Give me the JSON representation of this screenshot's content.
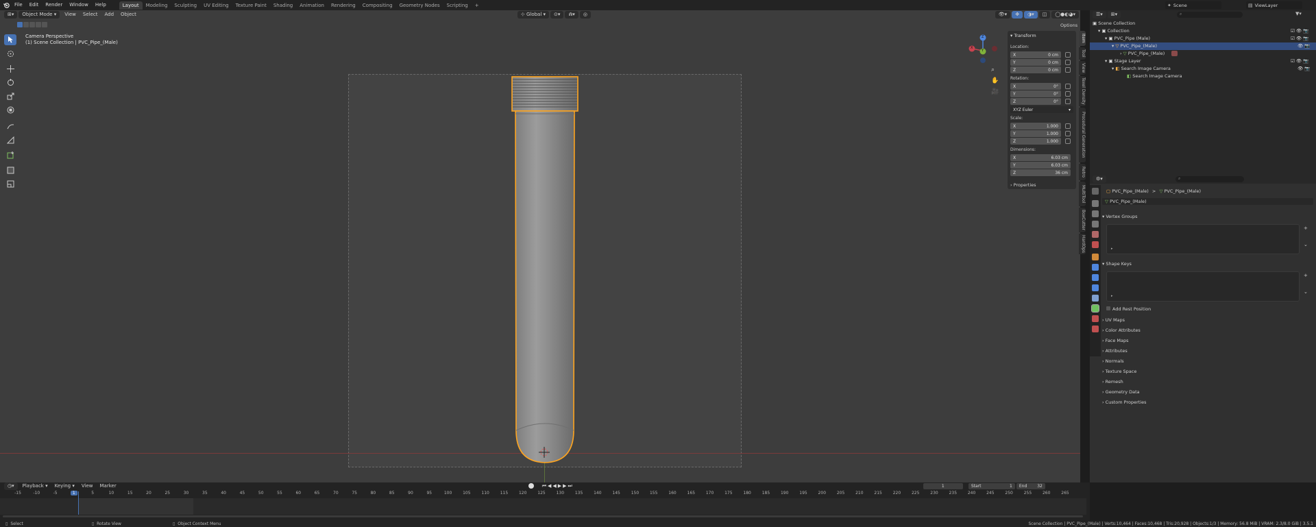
{
  "menu": {
    "items": [
      "File",
      "Edit",
      "Render",
      "Window",
      "Help"
    ]
  },
  "workspaces": {
    "tabs": [
      "Layout",
      "Modeling",
      "Sculpting",
      "UV Editing",
      "Texture Paint",
      "Shading",
      "Animation",
      "Rendering",
      "Compositing",
      "Geometry Nodes",
      "Scripting"
    ],
    "active": "Layout",
    "add": "+"
  },
  "scene": {
    "name": "Scene",
    "view_layer": "ViewLayer"
  },
  "viewport": {
    "mode": "Object Mode",
    "view": "View",
    "select": "Select",
    "add": "Add",
    "object": "Object",
    "transform_orientation": "Global",
    "options": "Options",
    "overlay_title": "Camera Perspective",
    "overlay_subtitle": "(1) Scene Collection | PVC_Pipe_(Male)",
    "gizmo_x": "X",
    "gizmo_y": "Y",
    "gizmo_z": "Z"
  },
  "npanel": {
    "transform": "Transform",
    "location_label": "Location:",
    "loc": {
      "x": "0 cm",
      "y": "0 cm",
      "z": "0 cm"
    },
    "rotation_label": "Rotation:",
    "rot": {
      "x": "0°",
      "y": "0°",
      "z": "0°"
    },
    "rotation_mode": "XYZ Euler",
    "scale_label": "Scale:",
    "scale": {
      "x": "1.000",
      "y": "1.000",
      "z": "1.000"
    },
    "dimensions_label": "Dimensions:",
    "dim": {
      "x": "6.03 cm",
      "y": "6.03 cm",
      "z": "36 cm"
    },
    "properties": "Properties",
    "axis": {
      "x": "X",
      "y": "Y",
      "z": "Z"
    },
    "tabs": [
      "Item",
      "Tool",
      "View",
      "Texel Density",
      "Procedural Generation",
      "Retro",
      "MultiTool",
      "BoxCutter",
      "HardOps"
    ]
  },
  "outliner": {
    "rows": [
      {
        "label": "Scene Collection"
      },
      {
        "label": "Collection"
      },
      {
        "label": "PVC_Pipe (Male)"
      },
      {
        "label": "PVC_Pipe_(Male)"
      },
      {
        "label": "PVC_Pipe_(Male)"
      },
      {
        "label": "Stage Layer"
      },
      {
        "label": "Search Image Camera"
      },
      {
        "label": "Search Image Camera"
      }
    ]
  },
  "properties": {
    "breadcrumb_obj": "PVC_Pipe_(Male)",
    "breadcrumb_sep": ">",
    "breadcrumb_mesh": "PVC_Pipe_(Male)",
    "data_name": "PVC_Pipe_(Male)",
    "vertex_groups": "Vertex Groups",
    "shape_keys": "Shape Keys",
    "add_rest_position": "Add Rest Position",
    "sections": [
      "UV Maps",
      "Color Attributes",
      "Face Maps",
      "Attributes",
      "Normals",
      "Texture Space",
      "Remesh",
      "Geometry Data",
      "Custom Properties"
    ]
  },
  "timeline": {
    "playback": "Playback",
    "keying": "Keying",
    "view": "View",
    "marker": "Marker",
    "current_frame": "1",
    "start_label": "Start",
    "start": "1",
    "end_label": "End",
    "end": "32",
    "ticks": [
      "-15",
      "-10",
      "-5",
      "1",
      "5",
      "10",
      "15",
      "20",
      "25",
      "30",
      "35",
      "40",
      "45",
      "50",
      "55",
      "60",
      "65",
      "70",
      "75",
      "80",
      "85",
      "90",
      "95",
      "100",
      "105",
      "110",
      "115",
      "120",
      "125",
      "130",
      "135",
      "140",
      "145",
      "150",
      "155",
      "160",
      "165",
      "170",
      "175",
      "180",
      "185",
      "190",
      "195",
      "200",
      "205",
      "210",
      "215",
      "220",
      "225",
      "230",
      "235",
      "240",
      "245",
      "250",
      "255",
      "260",
      "265"
    ]
  },
  "statusbar": {
    "select": "Select",
    "rotate_view": "Rotate View",
    "context_menu": "Object Context Menu",
    "stats": "Scene Collection | PVC_Pipe_(Male) | Verts:10,464 | Faces:10,468 | Tris:20,928 | Objects:1/3 | Memory: 56.8 MiB | VRAM: 2.3/8.0 GiB | 3.5.1"
  },
  "colors": {
    "accent": "#4772b3",
    "selection": "#f0a020",
    "viewport_bg": "#3d3d3d",
    "panel": "#303030"
  }
}
